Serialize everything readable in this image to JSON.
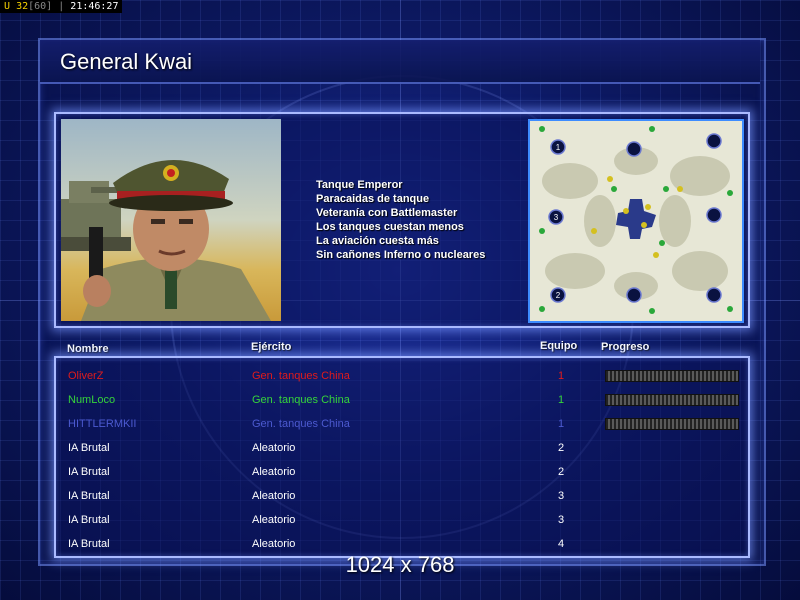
{
  "hud": {
    "u_label": "U",
    "fps": "32",
    "fps_cap": "[60]",
    "sep": "|",
    "clock": "21:46:27"
  },
  "title": "General Kwai",
  "perks": [
    "Tanque Emperor",
    "Paracaidas de tanque",
    "Veteranía con Battlemaster",
    "Los tanques cuestan menos",
    "La aviación cuesta más",
    "Sin cañones Inferno o nucleares"
  ],
  "map": {
    "start_labels": [
      "1",
      "3",
      "2"
    ]
  },
  "columns": {
    "name": "Nombre",
    "army": "Ejército",
    "team": "Equipo",
    "progress": "Progreso"
  },
  "players": [
    {
      "name": "OliverZ",
      "army": "Gen. tanques China",
      "team": "1",
      "color": "#e11b1b",
      "progress": 1.0
    },
    {
      "name": "NumLoco",
      "army": "Gen. tanques China",
      "team": "1",
      "color": "#35d43a",
      "progress": 1.0
    },
    {
      "name": "HITTLERMKII",
      "army": "Gen. tanques China",
      "team": "1",
      "color": "#4c5ad0",
      "progress": 1.0
    },
    {
      "name": "IA Brutal",
      "army": "Aleatorio",
      "team": "2",
      "color": "#ffffff"
    },
    {
      "name": "IA Brutal",
      "army": "Aleatorio",
      "team": "2",
      "color": "#ffffff"
    },
    {
      "name": "IA Brutal",
      "army": "Aleatorio",
      "team": "3",
      "color": "#ffffff"
    },
    {
      "name": "IA Brutal",
      "army": "Aleatorio",
      "team": "3",
      "color": "#ffffff"
    },
    {
      "name": "IA Brutal",
      "army": "Aleatorio",
      "team": "4",
      "color": "#ffffff"
    }
  ],
  "resolution": "1024 x 768"
}
